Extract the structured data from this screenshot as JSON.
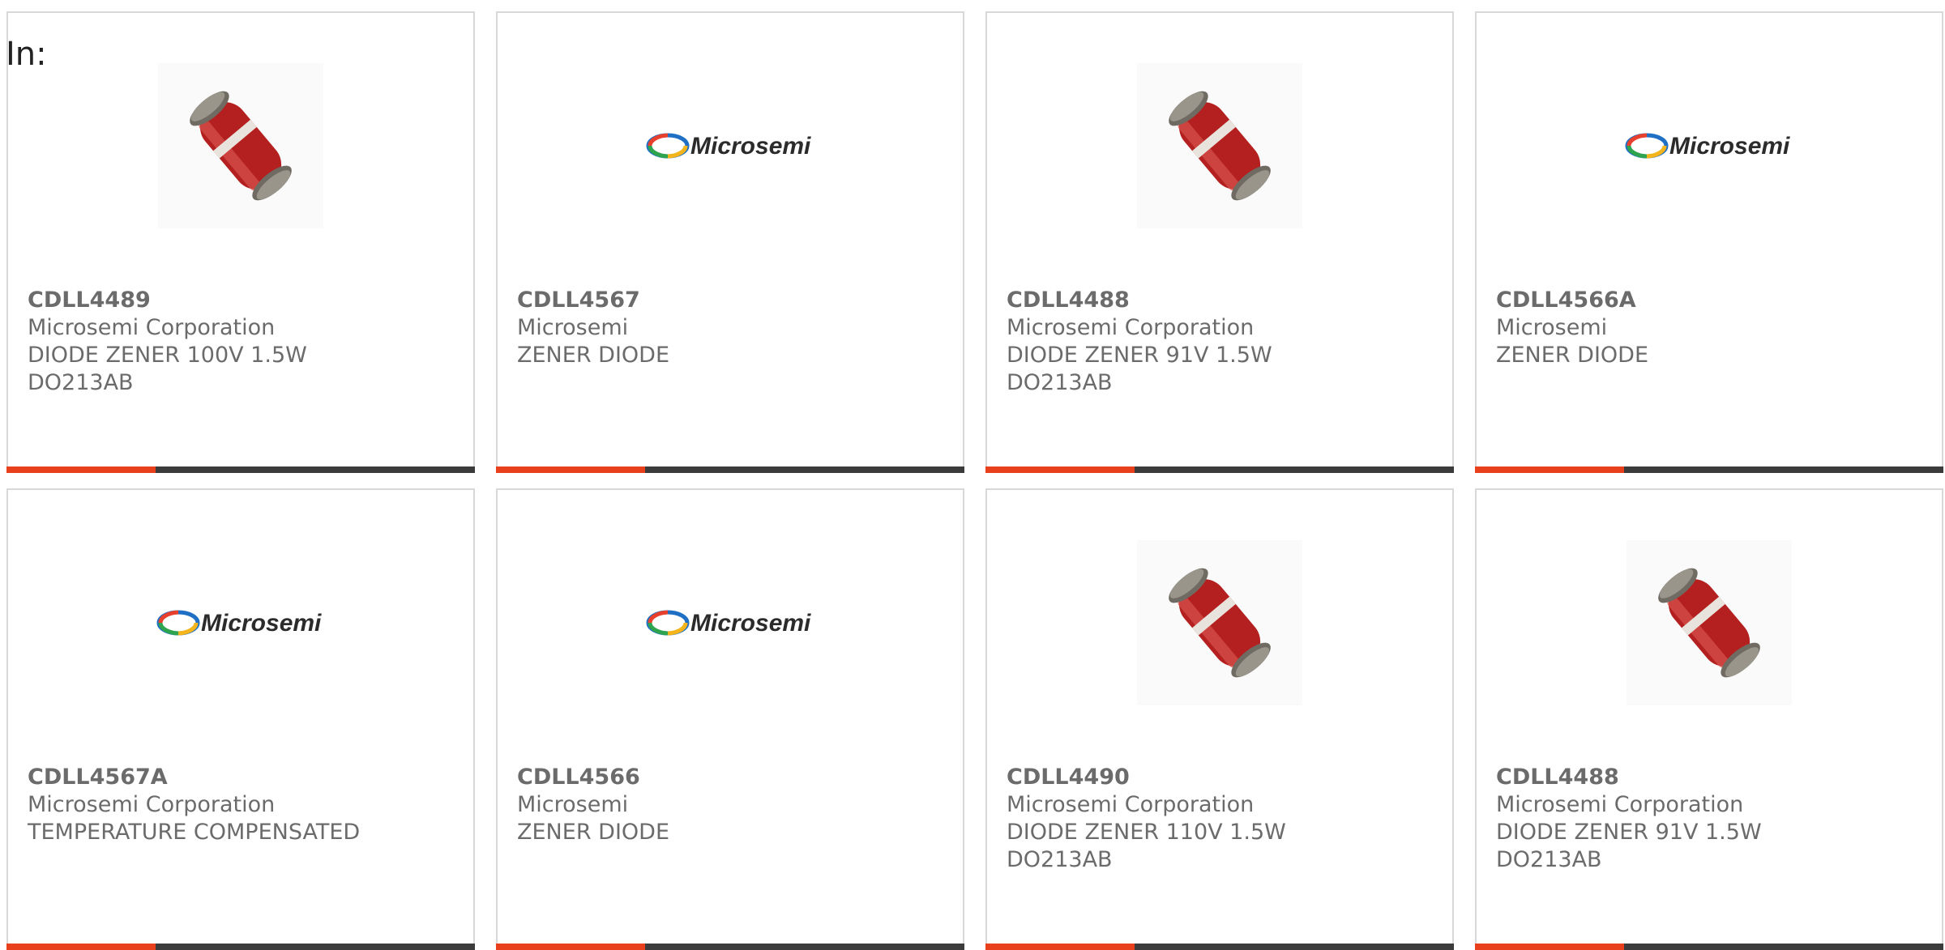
{
  "header": {
    "in_label": "In:"
  },
  "colors": {
    "accent_bar": "#e8401c",
    "dark_bar": "#3b3b3b",
    "card_border": "#d8d8d8",
    "text": "#6b6b6b"
  },
  "cards": [
    {
      "part_number": "CDLL4489",
      "manufacturer": "Microsemi Corporation",
      "lines": [
        "DIODE ZENER 100V 1.5W",
        "DO213AB"
      ],
      "image": "diode-photo"
    },
    {
      "part_number": "CDLL4567",
      "manufacturer": "Microsemi",
      "lines": [
        "ZENER DIODE"
      ],
      "image": "microsemi-logo",
      "logo_text": "Microsemi"
    },
    {
      "part_number": "CDLL4488",
      "manufacturer": "Microsemi Corporation",
      "lines": [
        "DIODE ZENER 91V 1.5W",
        "DO213AB"
      ],
      "image": "diode-photo"
    },
    {
      "part_number": "CDLL4566A",
      "manufacturer": "Microsemi",
      "lines": [
        "ZENER DIODE"
      ],
      "image": "microsemi-logo",
      "logo_text": "Microsemi"
    },
    {
      "part_number": "CDLL4567A",
      "manufacturer": "Microsemi Corporation",
      "lines": [
        "TEMPERATURE COMPENSATED"
      ],
      "image": "microsemi-logo",
      "logo_text": "Microsemi"
    },
    {
      "part_number": "CDLL4566",
      "manufacturer": "Microsemi",
      "lines": [
        "ZENER DIODE"
      ],
      "image": "microsemi-logo",
      "logo_text": "Microsemi"
    },
    {
      "part_number": "CDLL4490",
      "manufacturer": "Microsemi Corporation",
      "lines": [
        "DIODE ZENER 110V 1.5W",
        "DO213AB"
      ],
      "image": "diode-photo"
    },
    {
      "part_number": "CDLL4488",
      "manufacturer": "Microsemi Corporation",
      "lines": [
        "DIODE ZENER 91V 1.5W",
        "DO213AB"
      ],
      "image": "diode-photo"
    }
  ]
}
